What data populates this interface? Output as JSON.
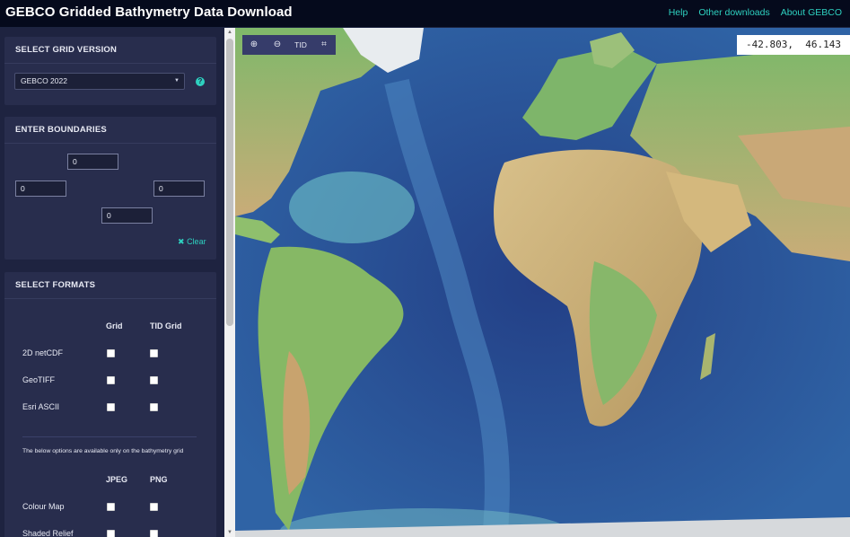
{
  "header": {
    "title": "GEBCO Gridded Bathymetry Data Download",
    "nav": [
      "Help",
      "Other downloads",
      "About GEBCO"
    ],
    "link_color": "#2ed1c0"
  },
  "grid_version": {
    "heading": "SELECT GRID VERSION",
    "selected": "GEBCO 2022",
    "help_icon": "?"
  },
  "boundaries": {
    "heading": "ENTER BOUNDARIES",
    "north": "0",
    "west": "0",
    "east": "0",
    "south": "0",
    "clear_label": "Clear"
  },
  "formats": {
    "heading": "SELECT FORMATS",
    "columns": [
      "Grid",
      "TID Grid"
    ],
    "rows": [
      {
        "label": "2D netCDF",
        "grid": false,
        "tid": false
      },
      {
        "label": "GeoTIFF",
        "grid": false,
        "tid": false
      },
      {
        "label": "Esri ASCII",
        "grid": false,
        "tid": false
      }
    ],
    "note": "The below options are available only on the bathymetry grid",
    "image_columns": [
      "JPEG",
      "PNG"
    ],
    "image_rows": [
      {
        "label": "Colour Map",
        "jpeg": false,
        "png": false
      },
      {
        "label": "Shaded Relief",
        "jpeg": false,
        "png": false
      }
    ]
  },
  "map": {
    "toolbar": {
      "zoom_in": "zoom-in-icon",
      "zoom_out": "zoom-out-icon",
      "tid_label": "TID",
      "grid": "grid-icon"
    },
    "coordinates": "-42.803,  46.143",
    "ocean_color": "#2d5f9e",
    "land_color": "#c8b07a"
  }
}
